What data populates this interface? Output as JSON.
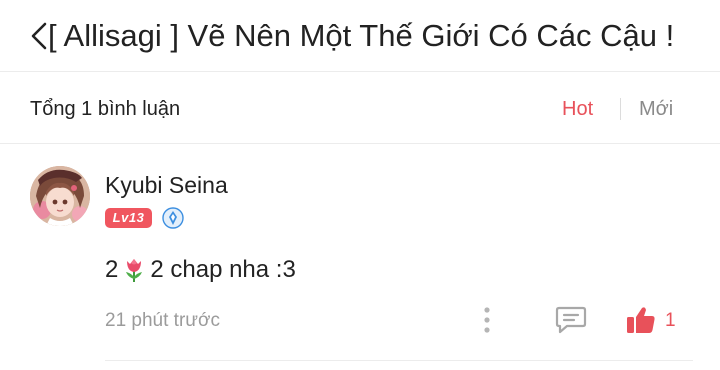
{
  "header": {
    "title": "[ Allisagi ] Vẽ Nên Một Thế Giới Có Các Cậu !",
    "back_icon": "chevron-left-icon"
  },
  "comments_bar": {
    "total_label": "Tổng 1 bình luận",
    "sort_hot": "Hot",
    "sort_new": "Mới",
    "active_sort": "Hot"
  },
  "comments": [
    {
      "username": "Kyubi Seina",
      "level": "Lv13",
      "text_before": "2",
      "emoji": "tulip-icon",
      "text_after": "2  chap nha :3",
      "time": "21 phút trước",
      "likes": "1"
    }
  ],
  "colors": {
    "accent": "#e8515a",
    "muted": "#9b9b9b",
    "divider": "#ececec",
    "rank_blue": "#3d8fe0"
  }
}
